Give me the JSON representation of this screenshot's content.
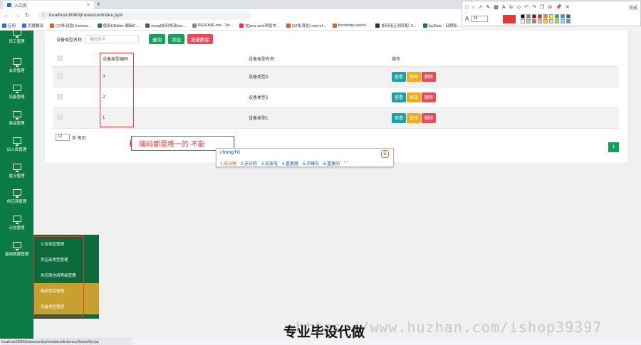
{
  "browser": {
    "tab_title": "入口页",
    "tab_close": "×",
    "new_tab": "+",
    "url": "localhost:8080/jinxiaocun/index.jsp#",
    "nav_icons": [
      "back-icon",
      "forward-icon",
      "reload-icon"
    ]
  },
  "bookmarks": [
    {
      "label": "应用",
      "color": "#1a73e8"
    },
    {
      "label": "百度翻译",
      "color": "#2979ff"
    },
    {
      "label": "(12条消息) freema...",
      "color": "#e55a2b"
    },
    {
      "label": "使用UEditor 编辑C...",
      "color": "#2e7d32"
    },
    {
      "label": "mysql如何修改roo...",
      "color": "#555555"
    },
    {
      "label": "README.md - Ter...",
      "color": "#888888"
    },
    {
      "label": "在java web项目中...",
      "color": "#e53935"
    },
    {
      "label": "(12条消息) root of...",
      "color": "#e55a2b"
    },
    {
      "label": "bootstrap-select...",
      "color": "#e55a2b"
    },
    {
      "label": "如何用正则匹配: 2...",
      "color": "#333333"
    },
    {
      "label": "layDate - 日期和...",
      "color": "#0c7a45"
    },
    {
      "label": "表单组件文档 - Lay...",
      "color": "#444444"
    },
    {
      "label": "(12条消息) 关于lay...",
      "color": "#e55a2b"
    }
  ],
  "annotation_toolbar": {
    "font_size": "18",
    "done_label": "完成",
    "big_color": "#e53935",
    "swatches": [
      "#000000",
      "#7f7f7f",
      "#880015",
      "#ed1c24",
      "#ff7f27",
      "#fff200",
      "#22b14c",
      "#00a2e8",
      "#3f48cc",
      "#ffffff",
      "#c3c3c3",
      "#b97a57",
      "#ffaec9",
      "#ffc90e",
      "#efe4b0",
      "#b5e61d",
      "#99d9ea",
      "#7092be"
    ]
  },
  "sidebar": {
    "items": [
      {
        "label": "员工管理"
      },
      {
        "label": "会员管理"
      },
      {
        "label": "设备管理"
      },
      {
        "label": "商品管理"
      },
      {
        "label": "出入库管理"
      },
      {
        "label": "盘点管理"
      },
      {
        "label": "供应商管理"
      },
      {
        "label": "公告管理"
      },
      {
        "label": "基础数据管理"
      }
    ]
  },
  "submenu": {
    "items": [
      {
        "label": "公告类型管理",
        "highlight": false
      },
      {
        "label": "供应商类型管理",
        "highlight": false
      },
      {
        "label": "供应商信用等级管理",
        "highlight": false
      },
      {
        "label": "物资类型管理",
        "highlight": true
      },
      {
        "label": "设备类型管理",
        "highlight": true
      }
    ]
  },
  "search": {
    "label": "设备类型名称",
    "placeholder": "编码名字",
    "query_button": "查询",
    "add_button": "添加",
    "batch_delete_button": "批量删除"
  },
  "table": {
    "headers": [
      "设备类型编码",
      "设备类型名称",
      "操作"
    ],
    "rows": [
      {
        "code": "3",
        "name": "设备类型3"
      },
      {
        "code": "2",
        "name": "设备类型2"
      },
      {
        "code": "1",
        "name": "设备类型1"
      }
    ],
    "actions": {
      "view": "查看",
      "edit": "修改",
      "delete": "删除"
    }
  },
  "pager": {
    "page_size": "10",
    "per_page_label": "条 每页",
    "current_page": "1"
  },
  "annotation_note": "编码都是唯一的  不能",
  "ime": {
    "input": "chong'f'd",
    "logo": "S",
    "candidates": [
      "1.充分地",
      "2.充分的",
      "3.充放电",
      "4.重复度",
      "5.冲锋队",
      "6.重复的",
      "‹ ›"
    ]
  },
  "status_url": "localhost:8080/jinxiaocun/jsp/modules/dictionaryGoods/list.jsp",
  "watermark": "专业毕设代做",
  "watermark_url": "https://www.huzhan.com/ishop39397"
}
